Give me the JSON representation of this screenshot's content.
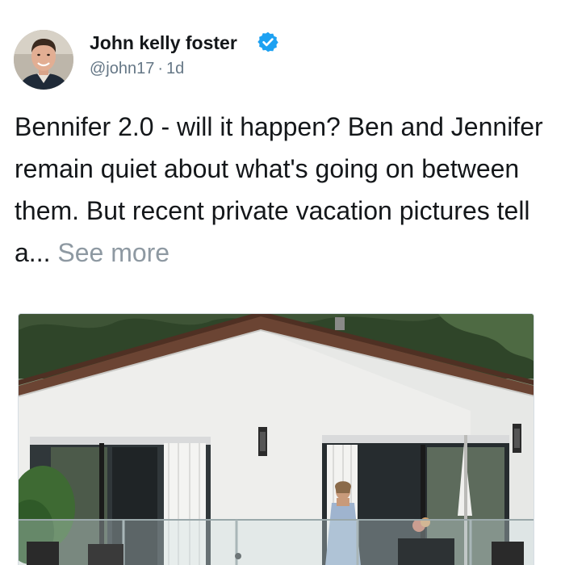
{
  "author": {
    "display_name": "John kelly foster",
    "handle": "@john17",
    "time_separator": "·",
    "timestamp": "1d",
    "verified": true,
    "verified_icon": "verified-badge-icon",
    "verified_color": "#1da1f2"
  },
  "tweet": {
    "text": "Bennifer 2.0 - will it happen? Ben and Jennifer remain quiet about what's going on between them. But recent private vacation pictures tell a...",
    "see_more_label": "See more",
    "see_more_color": "#8e99a2"
  },
  "colors": {
    "text": "#14171a",
    "secondary_text": "#657786",
    "background": "#ffffff"
  }
}
